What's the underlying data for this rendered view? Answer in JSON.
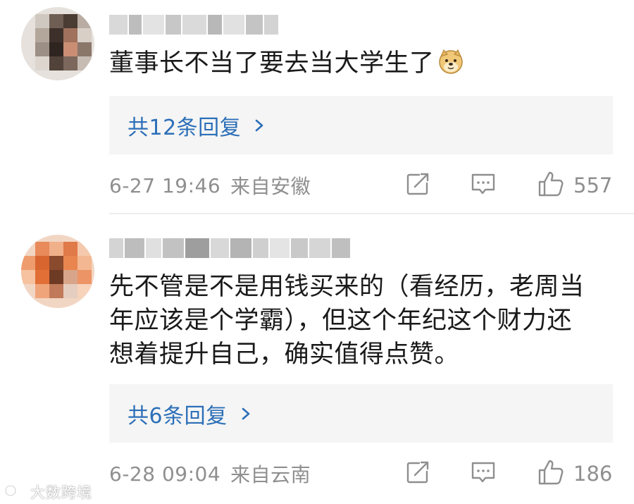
{
  "comments": [
    {
      "content": "董事长不当了要去当大学生了",
      "emoji": "doge-emoji",
      "replies_label": "共12条回复",
      "time": "6-27 19:46",
      "location": "来自安徽",
      "likes": "557"
    },
    {
      "content_lines": [
        "先不管是不是用钱买来的（看经历，老周当",
        "年应该是个学霸），但这个年纪这个财力还",
        "想着提升自己，确实值得点赞。"
      ],
      "replies_label": "共6条回复",
      "time": "6-28 09:04",
      "location": "来自云南",
      "likes": "186"
    }
  ],
  "icons": {
    "share": "share-icon",
    "comment": "comment-icon",
    "like": "thumbs-up-icon",
    "chevron": "chevron-right-icon"
  },
  "colors": {
    "link": "#2c6fb8",
    "meta": "#8f8f8f",
    "reply_bg": "#f5f5f5"
  },
  "watermark": {
    "text": "大数跨境"
  }
}
